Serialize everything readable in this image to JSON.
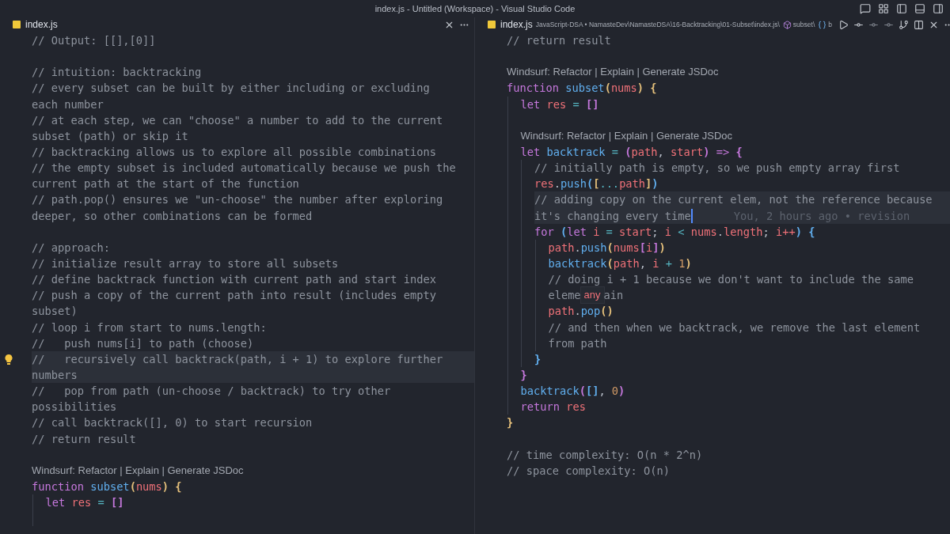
{
  "window": {
    "title": "index.js - Untitled (Workspace) - Visual Studio Code"
  },
  "panes": [
    {
      "tab": {
        "label": "index.js",
        "selected": true
      },
      "lines": [
        {
          "kind": "code",
          "tokens": [
            {
              "text": "// Output: [[],[0]]",
              "kind": "comment"
            }
          ]
        },
        {
          "kind": "blank"
        },
        {
          "kind": "code",
          "tokens": [
            {
              "text": "// intuition: backtracking",
              "kind": "comment"
            }
          ]
        },
        {
          "kind": "code",
          "tokens": [
            {
              "text": "// every subset can be built by either including or excluding",
              "kind": "comment"
            }
          ]
        },
        {
          "kind": "code",
          "tokens": [
            {
              "text": "each number",
              "kind": "comment"
            }
          ]
        },
        {
          "kind": "code",
          "tokens": [
            {
              "text": "// at each step, we can \"choose\" a number to add to the current",
              "kind": "comment"
            }
          ]
        },
        {
          "kind": "code",
          "tokens": [
            {
              "text": "subset (path) or skip it",
              "kind": "comment"
            }
          ]
        },
        {
          "kind": "code",
          "tokens": [
            {
              "text": "// backtracking allows us to explore all possible combinations",
              "kind": "comment"
            }
          ]
        },
        {
          "kind": "code",
          "tokens": [
            {
              "text": "// the empty subset is included automatically because we push the",
              "kind": "comment"
            }
          ]
        },
        {
          "kind": "code",
          "tokens": [
            {
              "text": "current path at the start of the function",
              "kind": "comment"
            }
          ]
        },
        {
          "kind": "code",
          "tokens": [
            {
              "text": "// path.pop() ensures we \"un-choose\" the number after exploring",
              "kind": "comment"
            }
          ]
        },
        {
          "kind": "code",
          "tokens": [
            {
              "text": "deeper, so other combinations can be formed",
              "kind": "comment"
            }
          ]
        },
        {
          "kind": "blank"
        },
        {
          "kind": "code",
          "tokens": [
            {
              "text": "// approach:",
              "kind": "comment"
            }
          ]
        },
        {
          "kind": "code",
          "tokens": [
            {
              "text": "// initialize result array to store all subsets",
              "kind": "comment"
            }
          ]
        },
        {
          "kind": "code",
          "tokens": [
            {
              "text": "// define backtrack function with current path and start index",
              "kind": "comment"
            }
          ]
        },
        {
          "kind": "code",
          "tokens": [
            {
              "text": "// push a copy of the current path into result (includes empty",
              "kind": "comment"
            }
          ]
        },
        {
          "kind": "code",
          "tokens": [
            {
              "text": "subset)",
              "kind": "comment"
            }
          ]
        },
        {
          "kind": "code",
          "tokens": [
            {
              "text": "// loop i from start to nums.length:",
              "kind": "comment"
            }
          ]
        },
        {
          "kind": "code",
          "tokens": [
            {
              "text": "//   push nums[i] to path (choose)",
              "kind": "comment"
            }
          ]
        },
        {
          "kind": "code",
          "highlighted": true,
          "lightbulb": true,
          "tokens": [
            {
              "text": "//   recursively call backtrack(path, i + 1) to explore further",
              "kind": "comment"
            }
          ]
        },
        {
          "kind": "code",
          "highlighted": true,
          "tokens": [
            {
              "text": "numbers",
              "kind": "comment"
            }
          ]
        },
        {
          "kind": "code",
          "tokens": [
            {
              "text": "//   pop from path (un-choose / backtrack) to try other",
              "kind": "comment"
            }
          ]
        },
        {
          "kind": "code",
          "tokens": [
            {
              "text": "possibilities",
              "kind": "comment"
            }
          ]
        },
        {
          "kind": "code",
          "tokens": [
            {
              "text": "// call backtrack([], 0) to start recursion",
              "kind": "comment"
            }
          ]
        },
        {
          "kind": "code",
          "tokens": [
            {
              "text": "// return result",
              "kind": "comment"
            }
          ]
        },
        {
          "kind": "blank"
        },
        {
          "kind": "code",
          "tokens": [
            {
              "text": "Windsurf: Refactor | Explain | Generate JSDoc",
              "kind": "lens"
            }
          ]
        },
        {
          "kind": "code",
          "tokens": [
            {
              "text": "function ",
              "kind": "keyword"
            },
            {
              "text": "subset",
              "kind": "function"
            },
            {
              "text": "(",
              "kind": "bracket",
              "color": "#e5c07b"
            },
            {
              "text": "nums",
              "kind": "variable"
            },
            {
              "text": ")",
              "kind": "bracket",
              "color": "#e5c07b"
            },
            {
              "text": " {",
              "kind": "bracket",
              "color": "#e5c07b"
            }
          ],
          "children": [
            {
              "kind": "code",
              "tokens": [
                {
                  "text": "let ",
                  "kind": "keyword"
                },
                {
                  "text": "res",
                  "kind": "variable"
                },
                {
                  "text": " = ",
                  "kind": "operator"
                },
                {
                  "text": "[]",
                  "kind": "bracket",
                  "color": "#c678dd"
                }
              ]
            },
            {
              "kind": "blank"
            }
          ]
        }
      ]
    },
    {
      "tab": {
        "label": "index.js",
        "selected": true
      },
      "breadcrumbs": [
        {
          "kind": "path",
          "text": "JavaScript-DSA • NamasteDev\\NamasteDSA\\16-Backtracking\\01-Subset\\index.js\\"
        },
        {
          "kind": "symbol",
          "text": "subset\\"
        },
        {
          "kind": "variable",
          "text": "b"
        }
      ],
      "lines": [
        {
          "kind": "code",
          "tokens": [
            {
              "text": "// return result",
              "kind": "comment"
            }
          ]
        },
        {
          "kind": "blank"
        },
        {
          "kind": "code",
          "tokens": [
            {
              "text": "Windsurf: Refactor | Explain | Generate JSDoc",
              "kind": "lens"
            }
          ]
        },
        {
          "kind": "code",
          "tokens": [
            {
              "text": "function ",
              "kind": "keyword"
            },
            {
              "text": "subset",
              "kind": "function"
            },
            {
              "text": "(",
              "kind": "bracket",
              "color": "#e5c07b"
            },
            {
              "text": "nums",
              "kind": "variable"
            },
            {
              "text": ")",
              "kind": "bracket",
              "color": "#e5c07b"
            },
            {
              "text": " {",
              "kind": "bracket",
              "color": "#e5c07b"
            }
          ],
          "children": [
            {
              "kind": "code",
              "tokens": [
                {
                  "text": "let ",
                  "kind": "keyword"
                },
                {
                  "text": "res",
                  "kind": "variable"
                },
                {
                  "text": " = ",
                  "kind": "operator"
                },
                {
                  "text": "[]",
                  "kind": "bracket",
                  "color": "#c678dd"
                }
              ]
            },
            {
              "kind": "blank"
            },
            {
              "kind": "code",
              "tokens": [
                {
                  "text": "Windsurf: Refactor | Explain | Generate JSDoc",
                  "kind": "lens"
                }
              ]
            },
            {
              "kind": "code",
              "tokens": [
                {
                  "text": "let ",
                  "kind": "keyword"
                },
                {
                  "text": "backtrack",
                  "kind": "function"
                },
                {
                  "text": " = ",
                  "kind": "operator"
                },
                {
                  "text": "(",
                  "kind": "bracket",
                  "color": "#c678dd"
                },
                {
                  "text": "path",
                  "kind": "variable"
                },
                {
                  "text": ", ",
                  "kind": "punct"
                },
                {
                  "text": "start",
                  "kind": "variable"
                },
                {
                  "text": ")",
                  "kind": "bracket",
                  "color": "#c678dd"
                },
                {
                  "text": " =>",
                  "kind": "keyword"
                },
                {
                  "text": " {",
                  "kind": "bracket",
                  "color": "#c678dd"
                }
              ],
              "children": [
                {
                  "kind": "code",
                  "tokens": [
                    {
                      "text": "// initially path is empty, so we push empty array first",
                      "kind": "comment"
                    }
                  ]
                },
                {
                  "kind": "code",
                  "tokens": [
                    {
                      "text": "res",
                      "kind": "variable"
                    },
                    {
                      "text": ".",
                      "kind": "punct"
                    },
                    {
                      "text": "push",
                      "kind": "function"
                    },
                    {
                      "text": "(",
                      "kind": "bracket",
                      "color": "#61afef"
                    },
                    {
                      "text": "[",
                      "kind": "bracket",
                      "color": "#e5c07b"
                    },
                    {
                      "text": "...",
                      "kind": "operator"
                    },
                    {
                      "text": "path",
                      "kind": "variable"
                    },
                    {
                      "text": "]",
                      "kind": "bracket",
                      "color": "#e5c07b"
                    },
                    {
                      "text": ")",
                      "kind": "bracket",
                      "color": "#61afef"
                    }
                  ]
                },
                {
                  "kind": "code",
                  "highlighted": true,
                  "tokens": [
                    {
                      "text": "// adding copy on the current elem, not the reference because",
                      "kind": "comment"
                    }
                  ]
                },
                {
                  "kind": "code",
                  "highlighted": true,
                  "tokens": [
                    {
                      "text": "it's changing every time",
                      "kind": "comment"
                    },
                    {
                      "kind": "cursor"
                    },
                    {
                      "text": "You, 2 hours ago • revision",
                      "kind": "blame"
                    }
                  ]
                },
                {
                  "kind": "code",
                  "tokens": [
                    {
                      "text": "for ",
                      "kind": "keyword"
                    },
                    {
                      "text": "(",
                      "kind": "bracket",
                      "color": "#61afef"
                    },
                    {
                      "text": "let ",
                      "kind": "keyword"
                    },
                    {
                      "text": "i",
                      "kind": "variable"
                    },
                    {
                      "text": " = ",
                      "kind": "operator"
                    },
                    {
                      "text": "start",
                      "kind": "variable"
                    },
                    {
                      "text": "; ",
                      "kind": "punct"
                    },
                    {
                      "text": "i",
                      "kind": "variable"
                    },
                    {
                      "text": " < ",
                      "kind": "operator"
                    },
                    {
                      "text": "nums",
                      "kind": "variable"
                    },
                    {
                      "text": ".",
                      "kind": "punct"
                    },
                    {
                      "text": "length",
                      "kind": "variable"
                    },
                    {
                      "text": "; ",
                      "kind": "punct"
                    },
                    {
                      "text": "i++",
                      "kind": "variable"
                    },
                    {
                      "text": ")",
                      "kind": "bracket",
                      "color": "#61afef"
                    },
                    {
                      "text": " {",
                      "kind": "bracket",
                      "color": "#61afef"
                    }
                  ],
                  "children": [
                    {
                      "kind": "code",
                      "tokens": [
                        {
                          "text": "path",
                          "kind": "variable"
                        },
                        {
                          "text": ".",
                          "kind": "punct"
                        },
                        {
                          "text": "push",
                          "kind": "function"
                        },
                        {
                          "text": "(",
                          "kind": "bracket",
                          "color": "#e5c07b"
                        },
                        {
                          "text": "nums",
                          "kind": "variable"
                        },
                        {
                          "text": "[",
                          "kind": "bracket",
                          "color": "#c678dd"
                        },
                        {
                          "text": "i",
                          "kind": "variable"
                        },
                        {
                          "text": "]",
                          "kind": "bracket",
                          "color": "#c678dd"
                        },
                        {
                          "text": ")",
                          "kind": "bracket",
                          "color": "#e5c07b"
                        }
                      ]
                    },
                    {
                      "kind": "code",
                      "tokens": [
                        {
                          "text": "backtrack",
                          "kind": "function"
                        },
                        {
                          "text": "(",
                          "kind": "bracket",
                          "color": "#e5c07b"
                        },
                        {
                          "text": "path",
                          "kind": "variable"
                        },
                        {
                          "text": ", ",
                          "kind": "punct"
                        },
                        {
                          "text": "i",
                          "kind": "variable"
                        },
                        {
                          "text": " + ",
                          "kind": "operator"
                        },
                        {
                          "text": "1",
                          "kind": "number"
                        },
                        {
                          "text": ")",
                          "kind": "bracket",
                          "color": "#e5c07b"
                        }
                      ]
                    },
                    {
                      "kind": "code",
                      "tokens": [
                        {
                          "text": "// doing i + 1 because we don't want to include the same",
                          "kind": "comment"
                        }
                      ]
                    },
                    {
                      "kind": "code",
                      "tokens": [
                        {
                          "text": "eleme",
                          "kind": "comment"
                        },
                        {
                          "text": "any",
                          "kind": "hover"
                        },
                        {
                          "text": "ain",
                          "kind": "comment"
                        }
                      ]
                    },
                    {
                      "kind": "code",
                      "tokens": [
                        {
                          "text": "path",
                          "kind": "variable"
                        },
                        {
                          "text": ".",
                          "kind": "punct"
                        },
                        {
                          "text": "pop",
                          "kind": "function"
                        },
                        {
                          "text": "()",
                          "kind": "bracket",
                          "color": "#e5c07b"
                        }
                      ]
                    },
                    {
                      "kind": "code",
                      "tokens": [
                        {
                          "text": "// and then when we backtrack, we remove the last element",
                          "kind": "comment"
                        }
                      ]
                    },
                    {
                      "kind": "code",
                      "tokens": [
                        {
                          "text": "from path",
                          "kind": "comment"
                        }
                      ]
                    }
                  ]
                },
                {
                  "kind": "code",
                  "tokens": [
                    {
                      "text": "}",
                      "kind": "bracket",
                      "color": "#61afef"
                    }
                  ]
                }
              ]
            },
            {
              "kind": "code",
              "tokens": [
                {
                  "text": "}",
                  "kind": "bracket",
                  "color": "#c678dd"
                }
              ]
            },
            {
              "kind": "code",
              "tokens": [
                {
                  "text": "backtrack",
                  "kind": "function"
                },
                {
                  "text": "(",
                  "kind": "bracket",
                  "color": "#c678dd"
                },
                {
                  "text": "[]",
                  "kind": "bracket",
                  "color": "#61afef"
                },
                {
                  "text": ", ",
                  "kind": "punct"
                },
                {
                  "text": "0",
                  "kind": "number"
                },
                {
                  "text": ")",
                  "kind": "bracket",
                  "color": "#c678dd"
                }
              ]
            },
            {
              "kind": "code",
              "tokens": [
                {
                  "text": "return ",
                  "kind": "keyword"
                },
                {
                  "text": "res",
                  "kind": "variable"
                }
              ]
            }
          ]
        },
        {
          "kind": "code",
          "tokens": [
            {
              "text": "}",
              "kind": "bracket",
              "color": "#e5c07b"
            }
          ]
        },
        {
          "kind": "blank"
        },
        {
          "kind": "code",
          "tokens": [
            {
              "text": "// time complexity: O(n * 2^n)",
              "kind": "comment"
            }
          ]
        },
        {
          "kind": "code",
          "tokens": [
            {
              "text": "// space complexity: O(n)",
              "kind": "comment"
            }
          ]
        }
      ]
    }
  ]
}
